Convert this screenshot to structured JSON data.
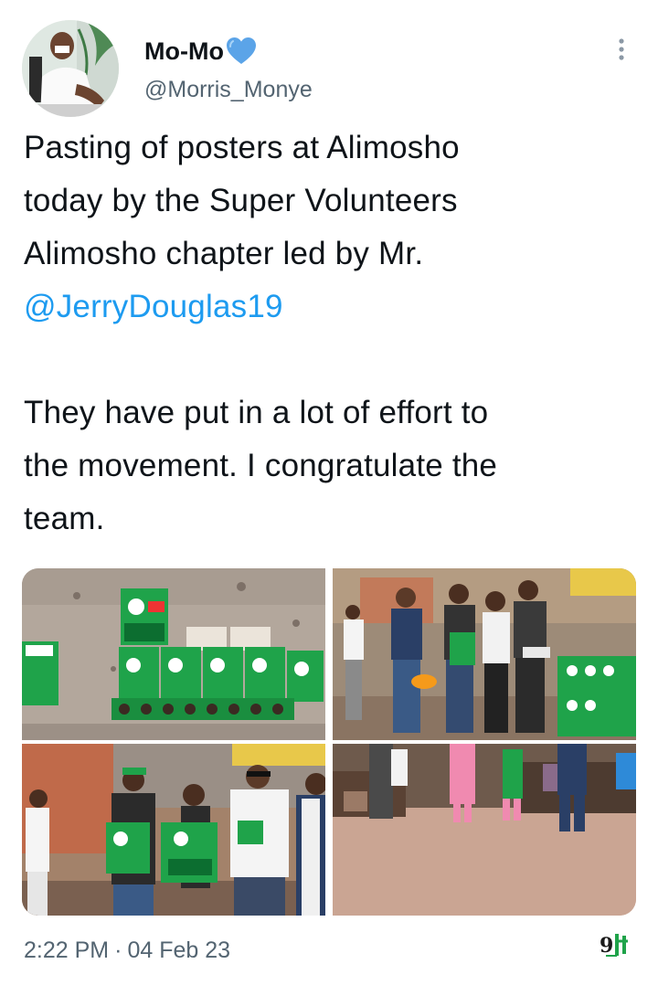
{
  "tweet": {
    "author": {
      "display_name": "Mo-Mo",
      "verified_badge_icon": "blue-heart-icon",
      "handle": "@Morris_Monye"
    },
    "text_line_1": "Pasting of posters at Alimosho",
    "text_line_2": "today by the Super Volunteers",
    "text_line_3": "Alimosho chapter led by Mr.",
    "mention": "@JerryDouglas19",
    "text_line_5": "They have put in a lot of effort to",
    "text_line_6": "the movement. I congratulate the",
    "text_line_7": "team.",
    "time": "2:22 PM",
    "separator": "·",
    "date": "04 Feb 23",
    "more_icon": "more-vertical-icon",
    "watermark_icon": "nigeria-9ja-logo-icon"
  },
  "colors": {
    "text": "#0f1419",
    "secondary": "#536471",
    "link": "#1d9bf0",
    "heart": "#5ba4e8",
    "poster_green": "#1fa34a"
  },
  "media": [
    {
      "name": "posters-on-wall-photo"
    },
    {
      "name": "volunteers-group-photo"
    },
    {
      "name": "volunteers-holding-posters-photo"
    },
    {
      "name": "street-scene-photo"
    }
  ]
}
